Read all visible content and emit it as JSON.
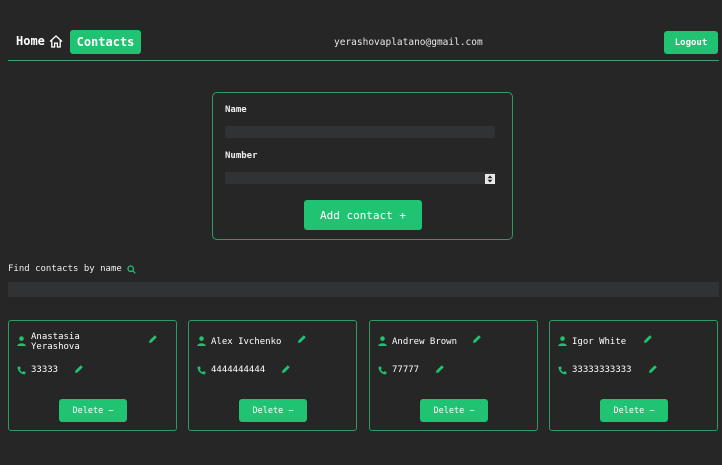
{
  "header": {
    "home_label": "Home",
    "contacts_label": "Contacts",
    "email": "yerashovaplatano@gmail.com",
    "logout_label": "Logout"
  },
  "form": {
    "name_label": "Name",
    "name_value": "",
    "number_label": "Number",
    "number_value": "",
    "submit_label": "Add contact +"
  },
  "filter": {
    "label": "Find contacts by name",
    "value": ""
  },
  "contacts": [
    {
      "name": "Anastasia Yerashova",
      "number": "33333",
      "delete_label": "Delete −"
    },
    {
      "name": "Alex Ivchenko",
      "number": "4444444444",
      "delete_label": "Delete −"
    },
    {
      "name": "Andrew Brown",
      "number": "77777",
      "delete_label": "Delete −"
    },
    {
      "name": "Igor White",
      "number": "33333333333",
      "delete_label": "Delete −"
    }
  ],
  "colors": {
    "background": "#262626",
    "accent": "#1fc372",
    "border": "#2f9a63",
    "input_bg": "#303234"
  }
}
